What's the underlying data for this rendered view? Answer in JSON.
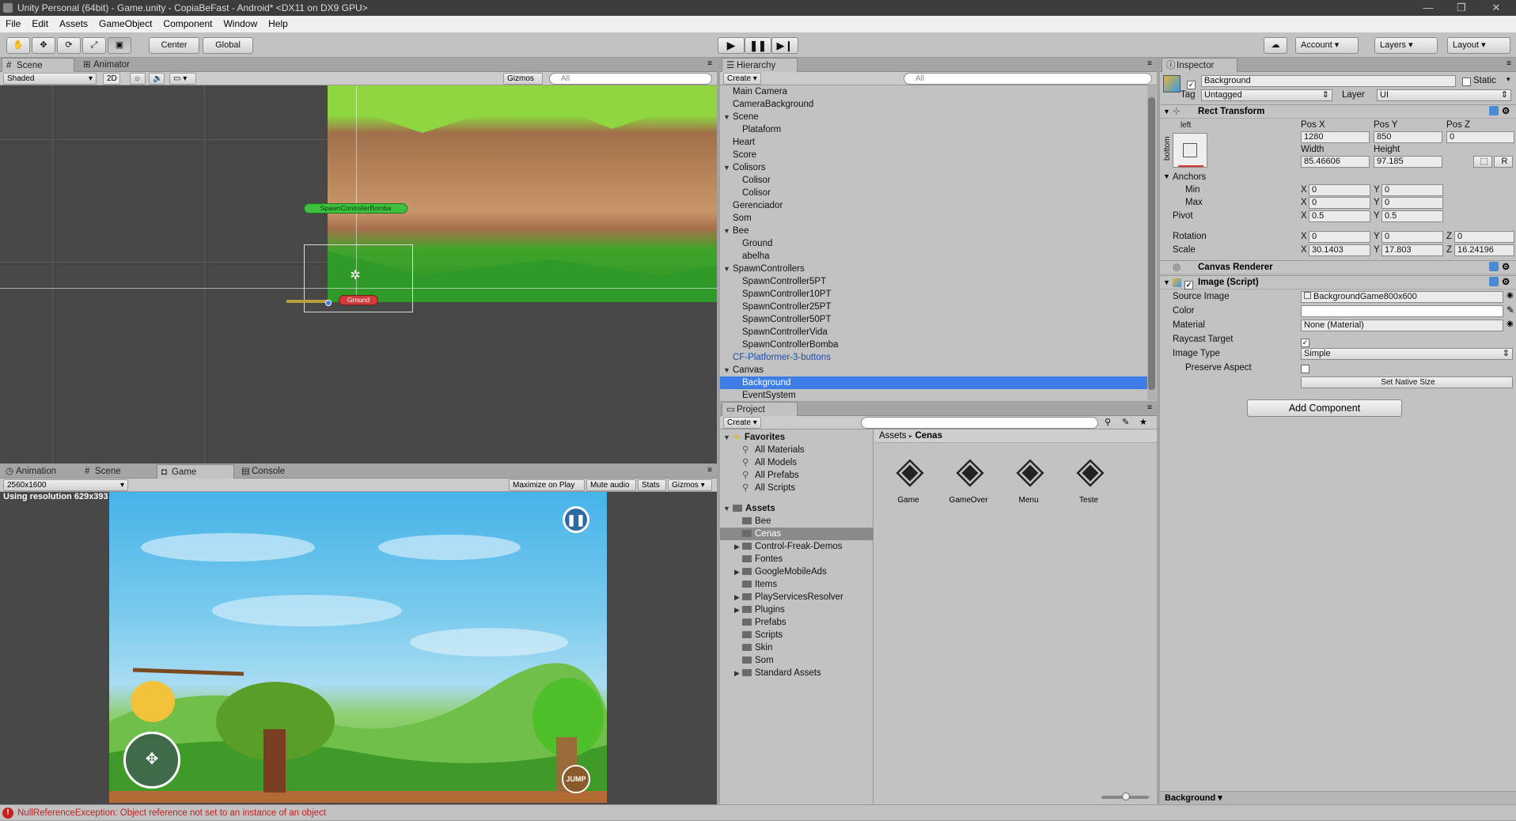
{
  "window": {
    "title": "Unity Personal (64bit) - Game.unity - CopiaBeFast - Android* <DX11 on DX9 GPU>",
    "minimize": "—",
    "maximize": "❐",
    "close": "✕"
  },
  "menu": [
    "File",
    "Edit",
    "Assets",
    "GameObject",
    "Component",
    "Window",
    "Help"
  ],
  "toolbar": {
    "pivot": "Center",
    "space": "Global",
    "account": "Account",
    "layers": "Layers",
    "layout": "Layout"
  },
  "scene": {
    "tabs": [
      "Scene",
      "Animator"
    ],
    "shading": "Shaded",
    "mode2d": "2D",
    "gizmos": "Gizmos",
    "search": "All",
    "label_spawn": "SpawnControllerBomba",
    "label_ground": "Ground"
  },
  "game": {
    "tabs": [
      "Animation",
      "Scene",
      "Game",
      "Console"
    ],
    "resolution": "2560x1600",
    "btn_maximize": "Maximize on Play",
    "btn_mute": "Mute audio",
    "btn_stats": "Stats",
    "btn_gizmos": "Gizmos",
    "res_text": "Using resolution 629x393",
    "jump": "JUMP"
  },
  "hierarchy": {
    "tab": "Hierarchy",
    "create": "Create",
    "search": "All",
    "items": [
      {
        "label": "Main Camera",
        "indent": 0,
        "arrow": ""
      },
      {
        "label": "CameraBackground",
        "indent": 0,
        "arrow": ""
      },
      {
        "label": "Scene",
        "indent": 0,
        "arrow": "▼"
      },
      {
        "label": "Plataform",
        "indent": 1,
        "arrow": ""
      },
      {
        "label": "Heart",
        "indent": 0,
        "arrow": ""
      },
      {
        "label": "Score",
        "indent": 0,
        "arrow": ""
      },
      {
        "label": "Colisors",
        "indent": 0,
        "arrow": "▼"
      },
      {
        "label": "Colisor",
        "indent": 1,
        "arrow": ""
      },
      {
        "label": "Colisor",
        "indent": 1,
        "arrow": ""
      },
      {
        "label": "Gerenciador",
        "indent": 0,
        "arrow": ""
      },
      {
        "label": "Som",
        "indent": 0,
        "arrow": ""
      },
      {
        "label": "Bee",
        "indent": 0,
        "arrow": "▼"
      },
      {
        "label": "Ground",
        "indent": 1,
        "arrow": ""
      },
      {
        "label": "abelha",
        "indent": 1,
        "arrow": ""
      },
      {
        "label": "SpawnControllers",
        "indent": 0,
        "arrow": "▼"
      },
      {
        "label": "SpawnController5PT",
        "indent": 1,
        "arrow": ""
      },
      {
        "label": "SpawnController10PT",
        "indent": 1,
        "arrow": ""
      },
      {
        "label": "SpawnController25PT",
        "indent": 1,
        "arrow": ""
      },
      {
        "label": "SpawnController50PT",
        "indent": 1,
        "arrow": ""
      },
      {
        "label": "SpawnControllerVida",
        "indent": 1,
        "arrow": ""
      },
      {
        "label": "SpawnControllerBomba",
        "indent": 1,
        "arrow": ""
      },
      {
        "label": "CF-Platformer-3-buttons",
        "indent": 0,
        "arrow": "",
        "blue": true
      },
      {
        "label": "Canvas",
        "indent": 0,
        "arrow": "▼"
      },
      {
        "label": "Background",
        "indent": 1,
        "arrow": "",
        "selected": true
      },
      {
        "label": "EventSystem",
        "indent": 1,
        "arrow": ""
      }
    ]
  },
  "project": {
    "tab": "Project",
    "create": "Create",
    "favorites_label": "Favorites",
    "favorites": [
      "All Materials",
      "All Models",
      "All Prefabs",
      "All Scripts"
    ],
    "assets_label": "Assets",
    "folders": [
      {
        "label": "Bee",
        "arrow": ""
      },
      {
        "label": "Cenas",
        "arrow": "",
        "selected": true
      },
      {
        "label": "Control-Freak-Demos",
        "arrow": "▶"
      },
      {
        "label": "Fontes",
        "arrow": ""
      },
      {
        "label": "GoogleMobileAds",
        "arrow": "▶"
      },
      {
        "label": "Items",
        "arrow": ""
      },
      {
        "label": "PlayServicesResolver",
        "arrow": "▶"
      },
      {
        "label": "Plugins",
        "arrow": "▶"
      },
      {
        "label": "Prefabs",
        "arrow": ""
      },
      {
        "label": "Scripts",
        "arrow": ""
      },
      {
        "label": "Skin",
        "arrow": ""
      },
      {
        "label": "Som",
        "arrow": ""
      },
      {
        "label": "Standard Assets",
        "arrow": "▶"
      }
    ],
    "breadcrumb_root": "Assets",
    "breadcrumb_sep": "▸",
    "breadcrumb_current": "Cenas",
    "scenes": [
      "Game",
      "GameOver",
      "Menu",
      "Teste"
    ]
  },
  "inspector": {
    "tab": "Inspector",
    "object_name": "Background",
    "static": "Static",
    "tag_label": "Tag",
    "tag": "Untagged",
    "layer_label": "Layer",
    "layer": "UI",
    "rect": {
      "title": "Rect Transform",
      "anchor_top": "left",
      "anchor_side": "bottom",
      "posx_label": "Pos X",
      "posy_label": "Pos Y",
      "posz_label": "Pos Z",
      "posx": "1280",
      "posy": "850",
      "posz": "0",
      "width_label": "Width",
      "height_label": "Height",
      "width": "85.46606",
      "height": "97.185",
      "r_btn": "R",
      "anchors_label": "Anchors",
      "min_label": "Min",
      "max_label": "Max",
      "min_x": "0",
      "min_y": "0",
      "max_x": "0",
      "max_y": "0",
      "pivot_label": "Pivot",
      "pivot_x": "0.5",
      "pivot_y": "0.5",
      "rotation_label": "Rotation",
      "rot_x": "0",
      "rot_y": "0",
      "rot_z": "0",
      "scale_label": "Scale",
      "scale_x": "30.1403",
      "scale_y": "17.803",
      "scale_z": "16.24196",
      "x": "X",
      "y": "Y",
      "z": "Z"
    },
    "canvas_renderer": "Canvas Renderer",
    "image": {
      "title": "Image (Script)",
      "source_label": "Source Image",
      "source": "BackgroundGame800x600",
      "color_label": "Color",
      "material_label": "Material",
      "material": "None (Material)",
      "raycast_label": "Raycast Target",
      "type_label": "Image Type",
      "type": "Simple",
      "preserve_label": "Preserve Aspect",
      "native_btn": "Set Native Size"
    },
    "add_component": "Add Component",
    "footer": "Background"
  },
  "status": {
    "message": "NullReferenceException: Object reference not set to an instance of an object"
  },
  "colors": {
    "selection": "#3e7de7",
    "panel": "#c2c2c2",
    "scene_bg": "#474747",
    "error": "#c81e1e"
  }
}
